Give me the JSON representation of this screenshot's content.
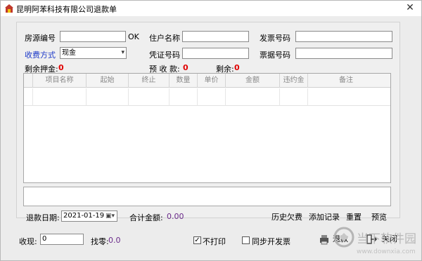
{
  "window": {
    "title": "昆明阿苯科技有限公司退款单",
    "close_label": "✕"
  },
  "form": {
    "house_no": {
      "label": "房源编号",
      "value": "",
      "ok_label": "OK"
    },
    "tenant_name": {
      "label": "住户名称",
      "value": ""
    },
    "invoice_no": {
      "label": "发票号码",
      "value": ""
    },
    "charge_method": {
      "label": "收费方式",
      "value": "现金"
    },
    "voucher_no": {
      "label": "凭证号码",
      "value": ""
    },
    "receipt_no": {
      "label": "票据号码",
      "value": ""
    },
    "deposit_left": {
      "label": "剩余押金:",
      "value": "0"
    },
    "prepaid": {
      "label": "预 收 款:",
      "value": "0"
    },
    "remain": {
      "label": "剩余:",
      "value": "0"
    }
  },
  "table": {
    "columns": [
      "项目名称",
      "起始",
      "终止",
      "数量",
      "单价",
      "金额",
      "违约金",
      "备注"
    ],
    "rows": []
  },
  "footer": {
    "refund_date": {
      "label": "退款日期:",
      "value": "2021-01-19"
    },
    "total": {
      "label": "合计金额:",
      "value": "0.00"
    },
    "links": {
      "history_debt": "历史欠费",
      "add_record": "添加记录",
      "reset": "重置",
      "preview": "预览"
    },
    "cash": {
      "label": "收现:",
      "value": "0"
    },
    "change": {
      "label": "找零:",
      "value": "0.0"
    },
    "no_print": {
      "label": "不打印",
      "checked": true
    },
    "sync_invoice": {
      "label": "同步开发票",
      "checked": false
    },
    "refund_btn": "退款",
    "close_btn": "关闭"
  },
  "watermark": {
    "text": "当下软件园",
    "sub": "www.downxia.com"
  },
  "colors": {
    "accent_blue": "#1c39c8",
    "value_red": "#e00000",
    "amount_purple": "#6a2a8a"
  }
}
